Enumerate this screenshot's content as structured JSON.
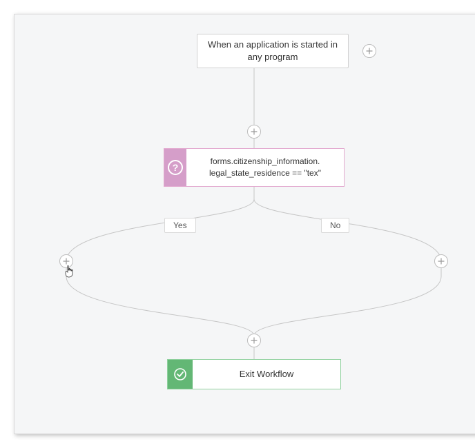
{
  "trigger": {
    "label": "When an application is started in any program"
  },
  "condition": {
    "expression": "forms.citizenship_information. legal_state_residence == \"tex\"",
    "icon_glyph": "?"
  },
  "branches": {
    "yes_label": "Yes",
    "no_label": "No"
  },
  "exit": {
    "label": "Exit Workflow"
  },
  "plus_glyph": "+"
}
